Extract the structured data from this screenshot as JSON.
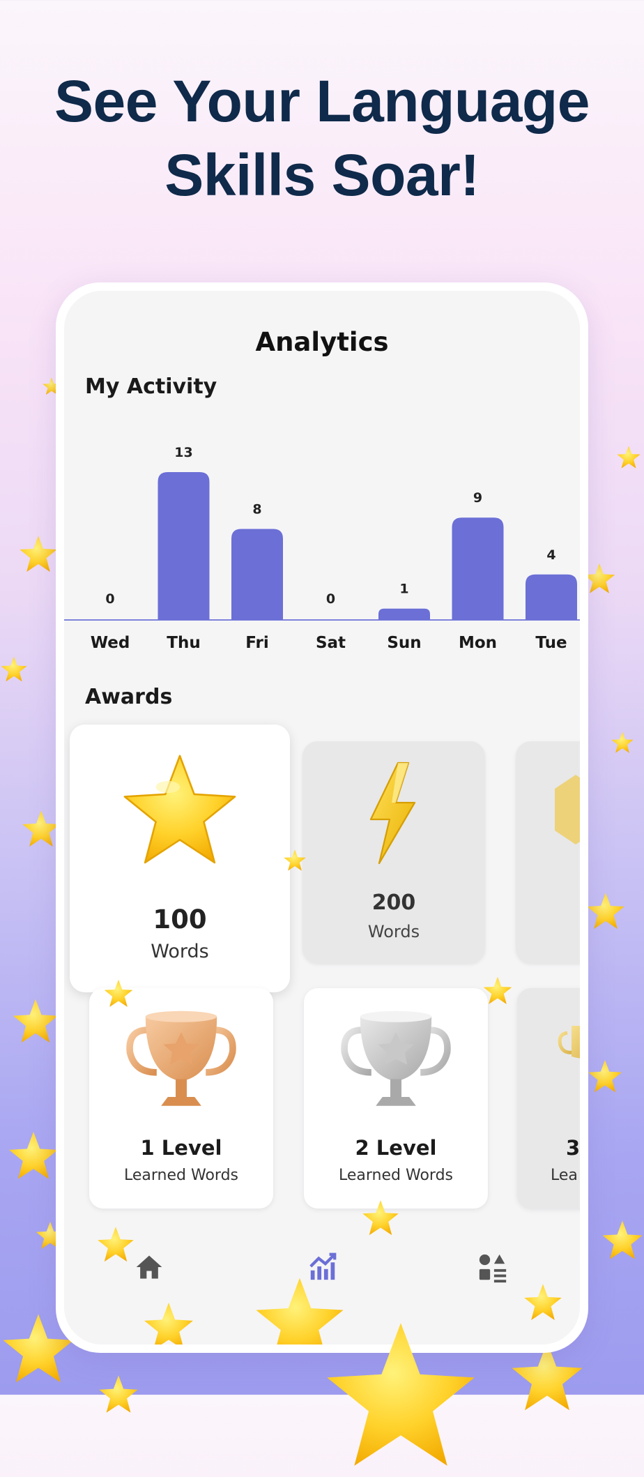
{
  "headline": {
    "line1": "See Your Language",
    "line2": "Skills Soar!"
  },
  "screen": {
    "title": "Analytics",
    "activity_title": "My Activity",
    "awards_title": "Awards"
  },
  "colors": {
    "bar": "#6b6fd6",
    "headline": "#0f2a4a",
    "active_nav": "#6b6fd6",
    "inactive_nav": "#555555"
  },
  "chart_data": {
    "type": "bar",
    "categories": [
      "Wed",
      "Thu",
      "Fri",
      "Sat",
      "Sun",
      "Mon",
      "Tue"
    ],
    "values": [
      0,
      13,
      8,
      0,
      1,
      9,
      4
    ],
    "title": "My Activity",
    "xlabel": "",
    "ylabel": "",
    "ylim": [
      0,
      13
    ],
    "grid": false
  },
  "awards": [
    {
      "value": "100",
      "label": "Words",
      "icon": "star-trophy-icon",
      "active": true
    },
    {
      "value": "200",
      "label": "Words",
      "icon": "lightning-icon",
      "active": false
    }
  ],
  "levels": [
    {
      "title": "1 Level",
      "subtitle": "Learned Words",
      "icon": "bronze-trophy-icon"
    },
    {
      "title": "2 Level",
      "subtitle": "Learned Words",
      "icon": "silver-trophy-icon"
    },
    {
      "title": "3",
      "subtitle": "Lea",
      "icon": "gold-trophy-icon"
    }
  ],
  "nav": [
    {
      "name": "home",
      "icon": "home-icon",
      "active": false
    },
    {
      "name": "analytics",
      "icon": "chart-icon",
      "active": true
    },
    {
      "name": "categories",
      "icon": "categories-icon",
      "active": false
    }
  ]
}
